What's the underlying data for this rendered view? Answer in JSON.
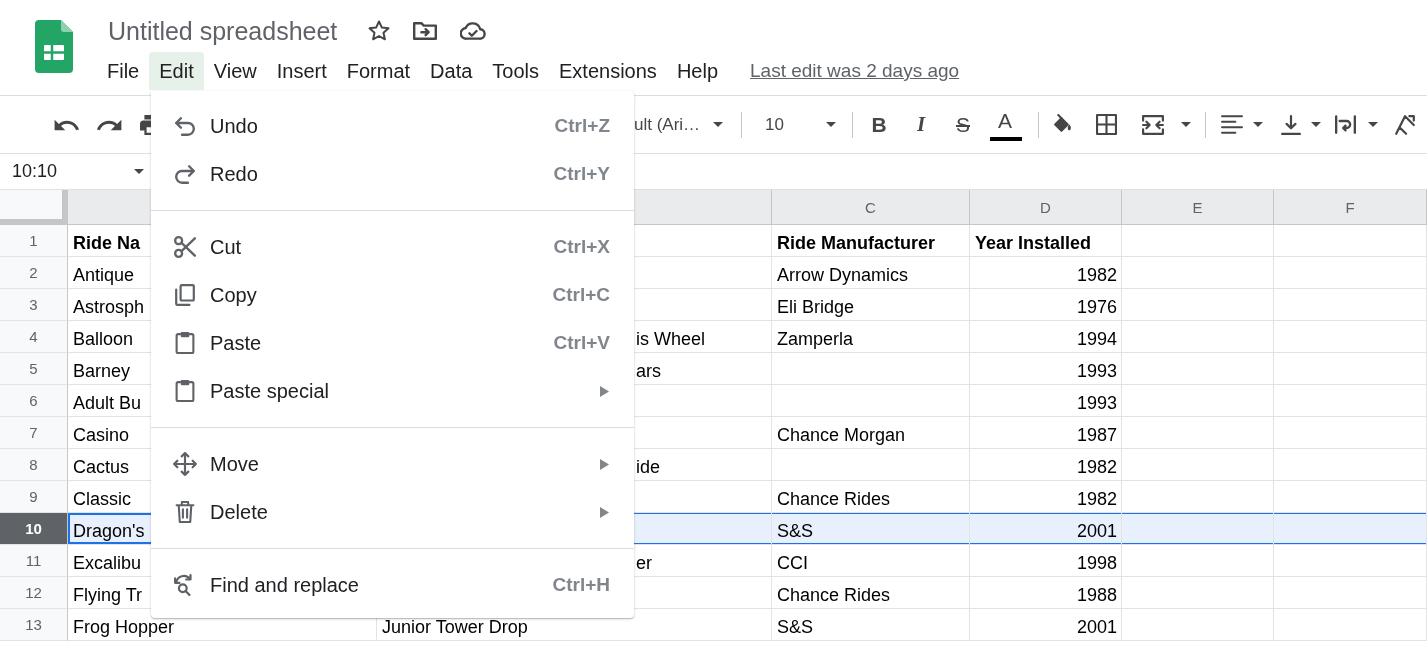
{
  "header": {
    "title": "Untitled spreadsheet",
    "menus": [
      {
        "label": "File",
        "selected": false
      },
      {
        "label": "Edit",
        "selected": true
      },
      {
        "label": "View",
        "selected": false
      },
      {
        "label": "Insert",
        "selected": false
      },
      {
        "label": "Format",
        "selected": false
      },
      {
        "label": "Data",
        "selected": false
      },
      {
        "label": "Tools",
        "selected": false
      },
      {
        "label": "Extensions",
        "selected": false
      },
      {
        "label": "Help",
        "selected": false
      }
    ],
    "last_edit": "Last edit was 2 days ago"
  },
  "toolbar": {
    "font": "ult (Ari…",
    "font_size": "10",
    "format_buttons": [
      {
        "kind": "bold",
        "label": "B"
      },
      {
        "kind": "italic",
        "label": "I"
      },
      {
        "kind": "strikethrough",
        "label": "S"
      },
      {
        "kind": "text_color",
        "label": "A"
      }
    ]
  },
  "name_box": {
    "value": "10:10"
  },
  "sheet": {
    "column_headers": [
      "C",
      "D",
      "E",
      "F"
    ],
    "rows": [
      {
        "number": "1",
        "kind": "heading",
        "selected": false,
        "col_a": "Ride Na",
        "col_c": "Ride Manufacturer",
        "col_d": "Year Installed"
      },
      {
        "number": "2",
        "kind": "data",
        "selected": false,
        "col_a": "Antique",
        "col_c": "Arrow Dynamics",
        "col_d": "1982"
      },
      {
        "number": "3",
        "kind": "data",
        "selected": false,
        "col_a": "Astrosph",
        "col_c": "Eli Bridge",
        "col_d": "1976"
      },
      {
        "number": "4",
        "kind": "data",
        "selected": false,
        "col_a": "Balloon",
        "col_b": "is Wheel",
        "col_c": "Zamperla",
        "col_d": "1994"
      },
      {
        "number": "5",
        "kind": "data",
        "selected": false,
        "col_a": "Barney",
        "col_b": "ars",
        "col_d": "1993"
      },
      {
        "number": "6",
        "kind": "data",
        "selected": false,
        "col_a": "Adult Bu",
        "col_d": "1993"
      },
      {
        "number": "7",
        "kind": "data",
        "selected": false,
        "col_a": "Casino",
        "col_c": "Chance Morgan",
        "col_d": "1987"
      },
      {
        "number": "8",
        "kind": "data",
        "selected": false,
        "col_a": "Cactus",
        "col_b": "ide",
        "col_d": "1982"
      },
      {
        "number": "9",
        "kind": "data",
        "selected": false,
        "col_a": "Classic",
        "col_c": "Chance Rides",
        "col_d": "1982"
      },
      {
        "number": "10",
        "kind": "data",
        "selected": true,
        "col_a": "Dragon's",
        "col_c": "S&S",
        "col_d": "2001"
      },
      {
        "number": "11",
        "kind": "data",
        "selected": false,
        "col_a": "Excalibu",
        "col_b": "er",
        "col_c": "CCI",
        "col_d": "1998"
      },
      {
        "number": "12",
        "kind": "data",
        "selected": false,
        "col_a": "Flying Tr",
        "col_c": "Chance Rides",
        "col_d": "1988"
      },
      {
        "number": "13",
        "kind": "data",
        "selected": false,
        "col_a": "Frog Hopper",
        "col_b": "Junior Tower Drop",
        "col_c": "S&S",
        "col_d": "2001"
      }
    ]
  },
  "edit_menu": {
    "sections": [
      {
        "items": [
          {
            "label": "Undo",
            "shortcut": "Ctrl+Z",
            "submenu": false
          },
          {
            "label": "Redo",
            "shortcut": "Ctrl+Y",
            "submenu": false
          }
        ]
      },
      {
        "items": [
          {
            "label": "Cut",
            "shortcut": "Ctrl+X",
            "submenu": false
          },
          {
            "label": "Copy",
            "shortcut": "Ctrl+C",
            "submenu": false
          },
          {
            "label": "Paste",
            "shortcut": "Ctrl+V",
            "submenu": false
          },
          {
            "label": "Paste special",
            "submenu": true
          }
        ]
      },
      {
        "items": [
          {
            "label": "Move",
            "submenu": true
          },
          {
            "label": "Delete",
            "submenu": true
          }
        ]
      },
      {
        "items": [
          {
            "label": "Find and replace",
            "shortcut": "Ctrl+H",
            "submenu": false
          }
        ]
      }
    ]
  }
}
